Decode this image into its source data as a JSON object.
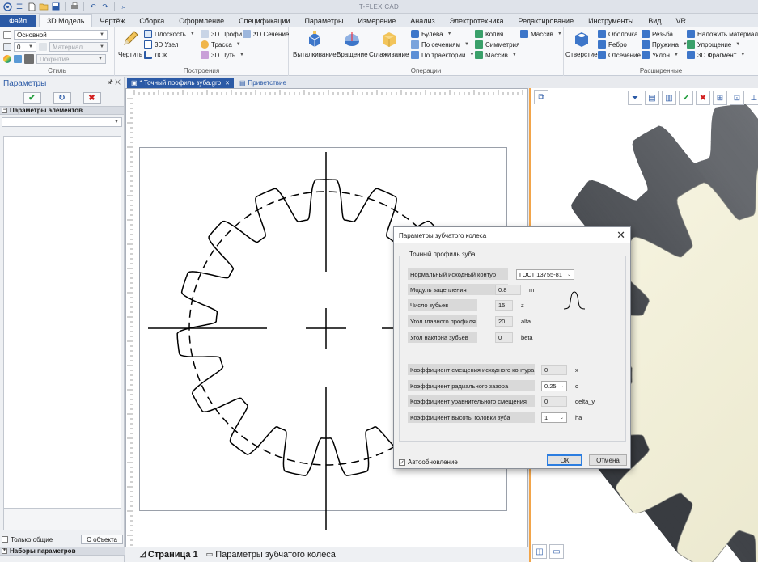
{
  "app": {
    "title": "T-FLEX CAD"
  },
  "quick_access": {
    "icons": [
      "app-logo-icon",
      "menu-icon",
      "new-file-icon",
      "open-folder-icon",
      "save-icon",
      "print-icon",
      "undo-icon",
      "redo-icon",
      "zoom-icon"
    ]
  },
  "ribbon_tabs": [
    {
      "label": "Файл"
    },
    {
      "label": "3D Модель"
    },
    {
      "label": "Чертёж"
    },
    {
      "label": "Сборка"
    },
    {
      "label": "Оформление"
    },
    {
      "label": "Спецификации"
    },
    {
      "label": "Параметры"
    },
    {
      "label": "Измерение"
    },
    {
      "label": "Анализ"
    },
    {
      "label": "Электротехника"
    },
    {
      "label": "Редактирование"
    },
    {
      "label": "Инструменты"
    },
    {
      "label": "Вид"
    },
    {
      "label": "VR"
    }
  ],
  "ribbon": {
    "style": {
      "label": "Стиль",
      "layer": "Основной",
      "level": "0",
      "material_placeholder": "Материал",
      "coating_placeholder": "Покрытие"
    },
    "construct": {
      "label": "Построения",
      "draw": "Чертить",
      "plane": "Плоскость",
      "node3d": "3D Узел",
      "lcs": "ЛСК",
      "profile3d": "3D Профиль",
      "path": "Трасса",
      "path3d": "3D Путь",
      "section3d": "3D Сечение"
    },
    "operations": {
      "label": "Операции",
      "extrude": "Выталкивание",
      "rotate": "Вращение",
      "smooth": "Сглаживание",
      "boolean": "Булева",
      "by_sections": "По сечениям",
      "by_path": "По траектории",
      "copy": "Копия",
      "symmetry": "Симметрия",
      "array1": "Массив",
      "array2": "Массив"
    },
    "extended": {
      "label": "Расширенные",
      "hole": "Отверстие",
      "shell": "Оболочка",
      "rib": "Ребро",
      "cut": "Отсечение",
      "thread": "Резьба",
      "spring": "Пружина",
      "slope": "Уклон",
      "apply_material": "Наложить материал",
      "simplify": "Упрощение",
      "fragment3d": "3D Фрагмент"
    }
  },
  "left_panel": {
    "title": "Параметры",
    "section_elements": "Параметры элементов",
    "only_common": "Только общие",
    "from_object": "С объекта",
    "param_sets": "Наборы параметров"
  },
  "doc_tabs": [
    {
      "label": "* Точный профиль зуба.grb"
    },
    {
      "label": "Приветствие"
    }
  ],
  "page_tabs": [
    {
      "label": "Страница 1"
    },
    {
      "label": "Параметры зубчатого колеса"
    }
  ],
  "dialog": {
    "title": "Параметры зубчатого колеса",
    "group_title": "Точный профиль зуба",
    "rows": [
      {
        "label": "Нормальный исходный контур",
        "value": "ГОСТ 13755-81",
        "unit": ""
      },
      {
        "label": "Модуль зацепления",
        "value": "0.8",
        "unit": "m"
      },
      {
        "label": "Число зубьев",
        "value": "15",
        "unit": "z"
      },
      {
        "label": "Угол главного профиля",
        "value": "20",
        "unit": "alfa"
      },
      {
        "label": "Угол наклона зубьев",
        "value": "0",
        "unit": "beta"
      },
      {
        "label": "Коэффициент смещения исходного контура",
        "value": "0",
        "unit": "x"
      },
      {
        "label": "Коэффициент радиального зазора",
        "value": "0.25",
        "unit": "c"
      },
      {
        "label": "Коэффициент уравнительного смещения",
        "value": "0",
        "unit": "delta_y"
      },
      {
        "label": "Коэффициент высоты головки зуба",
        "value": "1",
        "unit": "ha"
      }
    ],
    "auto_update": "Автообновление",
    "ok": "ОК",
    "cancel": "Отмена"
  },
  "colors": {
    "accent": "#2b5aa6",
    "view_border": "#f2a54a",
    "gear_dark": "#5d6168",
    "gear_face": "#f3f1dc"
  }
}
